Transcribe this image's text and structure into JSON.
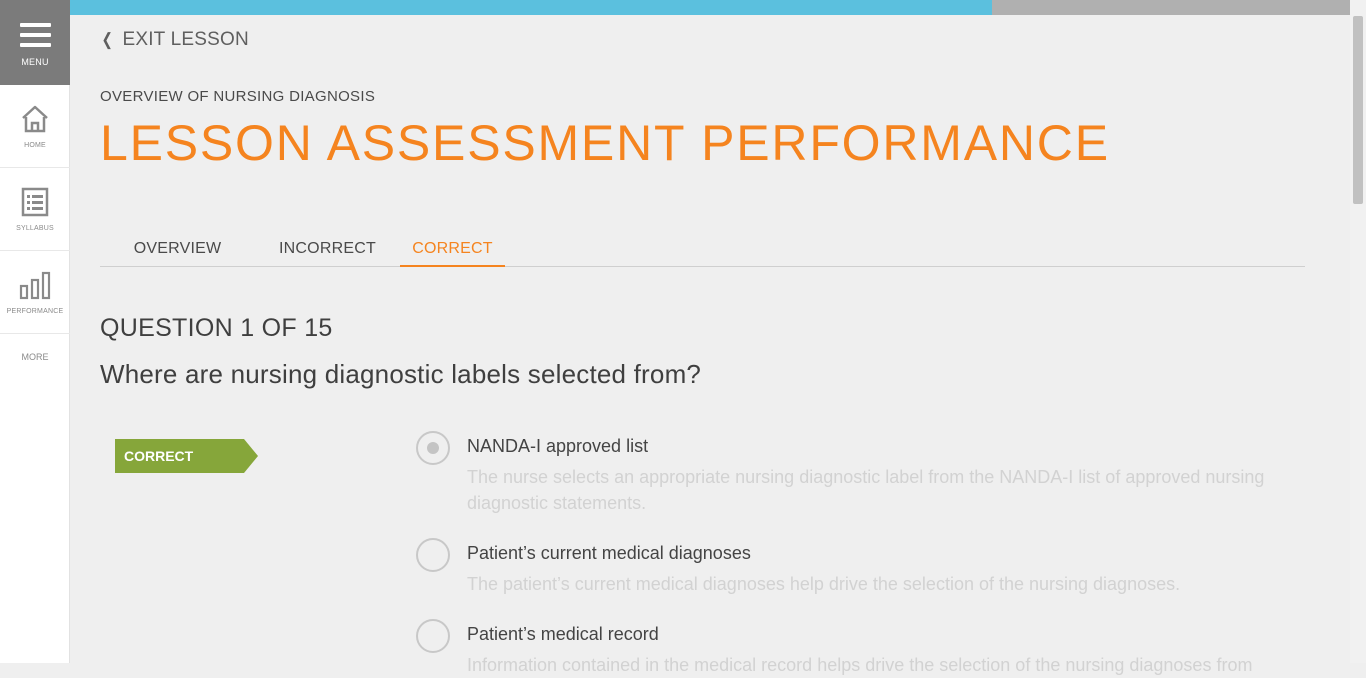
{
  "sidebar": {
    "menu_label": "MENU",
    "items": [
      {
        "label": "HOME",
        "icon": "home-icon"
      },
      {
        "label": "SYLLABUS",
        "icon": "syllabus-icon"
      },
      {
        "label": "PERFORMANCE",
        "icon": "performance-icon"
      }
    ],
    "more_label": "MORE"
  },
  "progress": {
    "fraction": 0.72,
    "fill_color": "#5bc0de",
    "track_color": "#b0b0b0"
  },
  "header": {
    "exit_label": "EXIT LESSON",
    "lesson_name": "OVERVIEW OF NURSING DIAGNOSIS",
    "title": "LESSON ASSESSMENT PERFORMANCE"
  },
  "tabs": [
    {
      "label": "OVERVIEW",
      "active": false
    },
    {
      "label": "INCORRECT",
      "active": false
    },
    {
      "label": "CORRECT",
      "active": true
    }
  ],
  "question": {
    "number_label": "QUESTION 1 OF 15",
    "text": "Where are nursing diagnostic labels selected from?",
    "result_badge": "CORRECT",
    "options": [
      {
        "label": "NANDA-I approved list",
        "selected": true,
        "rationale": "The nurse selects an appropriate nursing diagnostic label from the NANDA-I list of approved nursing diagnostic statements."
      },
      {
        "label": "Patient’s current medical diagnoses",
        "selected": false,
        "rationale": "The patient’s current medical diagnoses help drive the selection of the nursing diagnoses."
      },
      {
        "label": "Patient’s medical record",
        "selected": false,
        "rationale": "Information contained in the medical record helps drive the selection of the nursing diagnoses from"
      }
    ]
  },
  "colors": {
    "accent": "#f5841f",
    "correct": "#86a63a",
    "menu_bg": "#7b7b7b"
  }
}
